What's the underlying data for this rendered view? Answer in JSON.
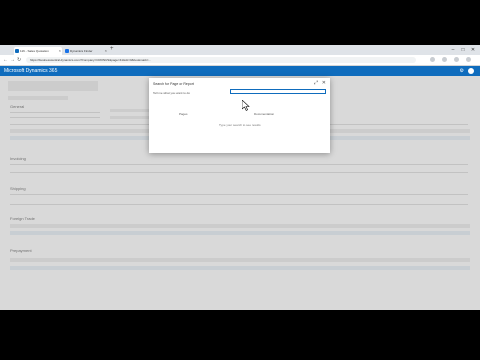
{
  "browser": {
    "tabs": [
      {
        "label": "116 - Sales Quotation",
        "active": true,
        "favicon_color": "#0f6cbd"
      },
      {
        "label": "Dynamics Finder",
        "active": false,
        "favicon_color": "#1a73e8"
      }
    ],
    "new_tab": "+",
    "url": "https://businesscentral.dynamics.com/?company=CRONUS&page=41&dc=0&bookmark=...",
    "window_controls": [
      "–",
      "□",
      "✕"
    ]
  },
  "app": {
    "title": "Microsoft Dynamics 365",
    "settings_icon": "gear-icon",
    "user_icon": "avatar"
  },
  "background": {
    "sections": [
      "General",
      "Invoicing",
      "Shipping",
      "Foreign Trade",
      "Prepayment"
    ]
  },
  "dialog": {
    "title": "Search for Page or Report",
    "prompt": "Tell me what you want to do",
    "input_value": "",
    "tab1": "Pages",
    "tab2": "Documentation",
    "empty_text": "Type your search to see results",
    "accent": "#0f6cbd"
  }
}
